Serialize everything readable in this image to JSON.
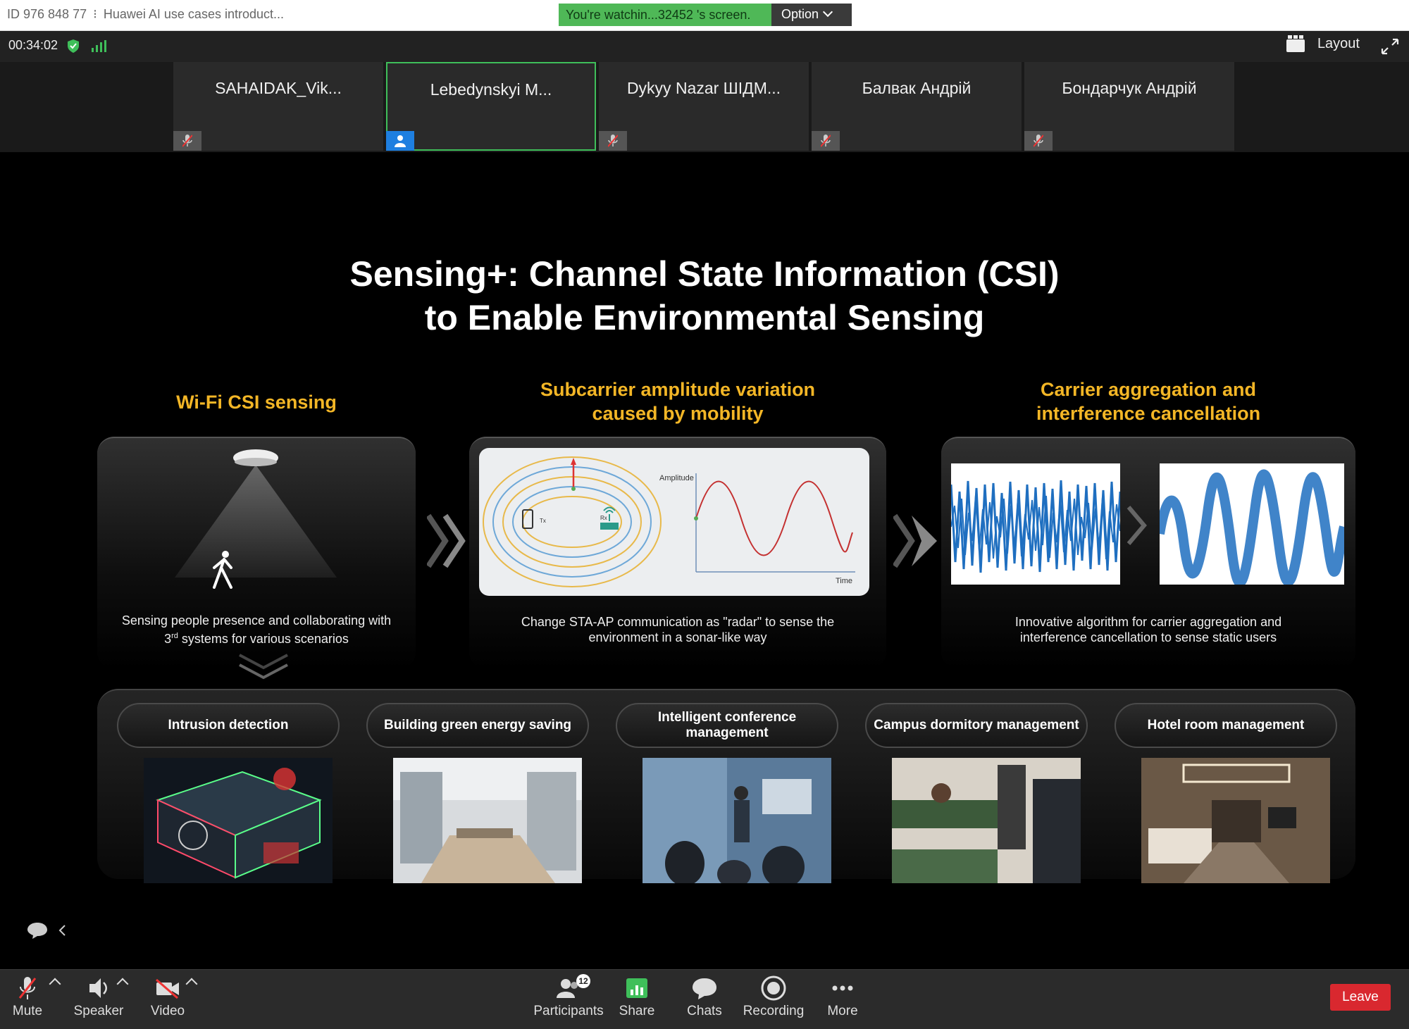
{
  "window": {
    "meeting_id": "ID 976 848 77",
    "separator": "⁝",
    "meeting_title": "Huawei AI use cases introduct..."
  },
  "share_banner": {
    "message": "You're watchin...32452 's screen.",
    "option_label": "Option"
  },
  "status": {
    "timer": "00:34:02",
    "layout_label": "Layout"
  },
  "participants": [
    {
      "name": "SAHAIDAK_Vik...",
      "muted": true,
      "active": false
    },
    {
      "name": "Lebedynskyi M...",
      "muted": false,
      "active": true
    },
    {
      "name": "Dykyy Nazar ШІДМ...",
      "muted": true,
      "active": false
    },
    {
      "name": "Балвак Андрій",
      "muted": true,
      "active": false
    },
    {
      "name": "Бондарчук Андрій",
      "muted": true,
      "active": false
    }
  ],
  "slide": {
    "title_line1": "Sensing+: Channel State Information (CSI)",
    "title_line2": "to Enable Environmental Sensing",
    "columns": [
      {
        "heading_line1": "Wi-Fi CSI sensing",
        "heading_line2": "",
        "caption_line1": "Sensing people presence and collaborating with",
        "caption_line2_prefix": "3",
        "caption_line2_sup": "rd",
        "caption_line2_suffix": " systems for various scenarios"
      },
      {
        "heading_line1": "Subcarrier amplitude variation",
        "heading_line2": "caused by mobility",
        "caption_line1": "Change STA-AP communication as \"radar\" to sense the",
        "caption_line2": "environment in a sonar-like way",
        "diagram": {
          "tx_label": "Tx",
          "rx_label": "Rx",
          "amplitude_label": "Amplitude",
          "time_label": "Time"
        }
      },
      {
        "heading_line1": "Carrier aggregation and",
        "heading_line2": "interference cancellation",
        "caption_line1": "Innovative algorithm for carrier aggregation and",
        "caption_line2": "interference cancellation to sense static users"
      }
    ],
    "applications": [
      {
        "label": "Intrusion detection"
      },
      {
        "label": "Building green energy saving"
      },
      {
        "label": "Intelligent conference management"
      },
      {
        "label": "Campus dormitory management"
      },
      {
        "label": "Hotel room management"
      }
    ]
  },
  "toolbar": {
    "mute": "Mute",
    "speaker": "Speaker",
    "video": "Video",
    "participants": "Participants",
    "participants_count": "12",
    "share": "Share",
    "chats": "Chats",
    "recording": "Recording",
    "more": "More",
    "leave": "Leave"
  },
  "colors": {
    "accent_yellow": "#f3b626",
    "banner_green": "#4fb857",
    "leave_red": "#d9282f",
    "active_border": "#3fbf5a"
  }
}
